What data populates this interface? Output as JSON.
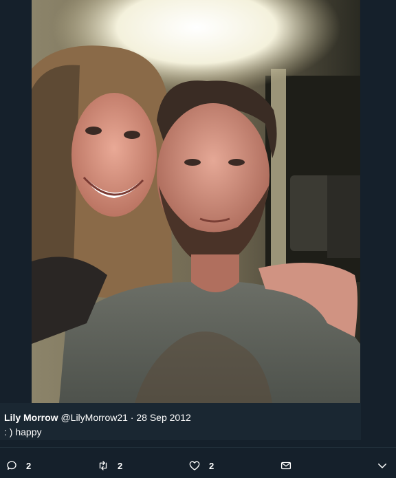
{
  "tweet": {
    "author_name": "Lily Morrow",
    "author_handle": "@LilyMorrow21",
    "separator": " · ",
    "date": "28 Sep 2012",
    "text": ": ) happy"
  },
  "actions": {
    "reply_count": "2",
    "retweet_count": "2",
    "like_count": "2"
  },
  "icons": {
    "reply": "reply-icon",
    "retweet": "retweet-icon",
    "like": "heart-icon",
    "share": "envelope-icon",
    "more": "chevron-down-icon"
  },
  "colors": {
    "background": "#15202b",
    "caption_band": "#1a2732",
    "text": "#ffffff",
    "icon": "#ffffff"
  }
}
